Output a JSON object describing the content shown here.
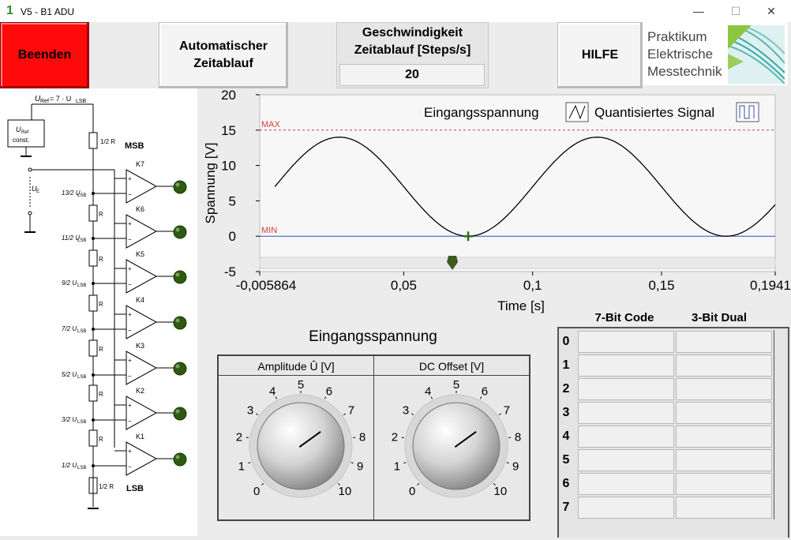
{
  "window": {
    "title": "V5 - B1 ADU",
    "app_icon": "1",
    "minimize_glyph": "—",
    "maximize_glyph": "☐",
    "close_glyph": "✕"
  },
  "toolbar": {
    "beenden_label": "Beenden",
    "auto_label_1": "Automatischer",
    "auto_label_2": "Zeitablauf",
    "speed_label_1": "Geschwindigkeit",
    "speed_label_2": "Zeitablauf [Steps/s]",
    "speed_value": "20",
    "hilfe_label": "HILFE"
  },
  "logo": {
    "line1": "Praktikum",
    "line2": "Elektrische",
    "line3": "Messtechnik"
  },
  "circuit": {
    "uref_label": "U",
    "uref_sub": "Ref",
    "uref_eq": "= 7 · U",
    "uref_lsb": "LSB",
    "uref_box_1": "U",
    "uref_box_sub": "Ref",
    "uref_box_2": "const.",
    "ue": "U",
    "ue_sub": "E",
    "msb": "MSB",
    "lsb": "LSB",
    "comparators": [
      "K7",
      "K6",
      "K5",
      "K4",
      "K3",
      "K2",
      "K1"
    ],
    "resistor_top": "1/2 R",
    "resistor_mid": "R",
    "resistor_bottom": "1/2 R",
    "tap_labels": [
      "13/2",
      "11/2",
      "9/2",
      "7/2",
      "5/2",
      "3/2",
      "1/2"
    ],
    "tap_unit": "U",
    "tap_sub": "LSB"
  },
  "chart_data": {
    "type": "line",
    "ylabel": "Spannung [V]",
    "xlabel": "Time [s]",
    "xlim": [
      -0.005864,
      0.1941
    ],
    "ylim": [
      -5,
      20
    ],
    "x_ticks": [
      "-0,005864",
      "0,05",
      "0,1",
      "0,15",
      "0,1941"
    ],
    "x_tick_values": [
      -0.005864,
      0.05,
      0.1,
      0.15,
      0.1941
    ],
    "y_ticks": [
      -5,
      0,
      5,
      10,
      15,
      20
    ],
    "legend": [
      "Eingangsspannung",
      "Quantisiertes Signal"
    ],
    "legend_position": "top-right",
    "max_line": {
      "label": "MAX",
      "value": 15,
      "color": "#d04040"
    },
    "min_line": {
      "label": "MIN",
      "value": 0,
      "color": "#3050c0"
    },
    "series": [
      {
        "name": "Eingangsspannung",
        "color": "#000000",
        "function": "sine",
        "amplitude": 7,
        "offset": 7,
        "frequency_hz": 10,
        "phase_zero_crossing_s": 0.05
      }
    ],
    "cursor": {
      "x": 0.075,
      "y": 0
    },
    "grid": false
  },
  "knobs": {
    "title": "Eingangsspannung",
    "amplitude": {
      "label": "Amplitude Û [V]",
      "value": 7,
      "ticks": [
        "0",
        "1",
        "2",
        "3",
        "4",
        "5",
        "6",
        "7",
        "8",
        "9",
        "10"
      ]
    },
    "offset": {
      "label": "DC Offset [V]",
      "value": 7,
      "ticks": [
        "0",
        "1",
        "2",
        "3",
        "4",
        "5",
        "6",
        "7",
        "8",
        "9",
        "10"
      ]
    }
  },
  "code_table": {
    "header_7bit": "7-Bit Code",
    "header_3bit": "3-Bit Dual",
    "rows": [
      "0",
      "1",
      "2",
      "3",
      "4",
      "5",
      "6",
      "7"
    ]
  }
}
